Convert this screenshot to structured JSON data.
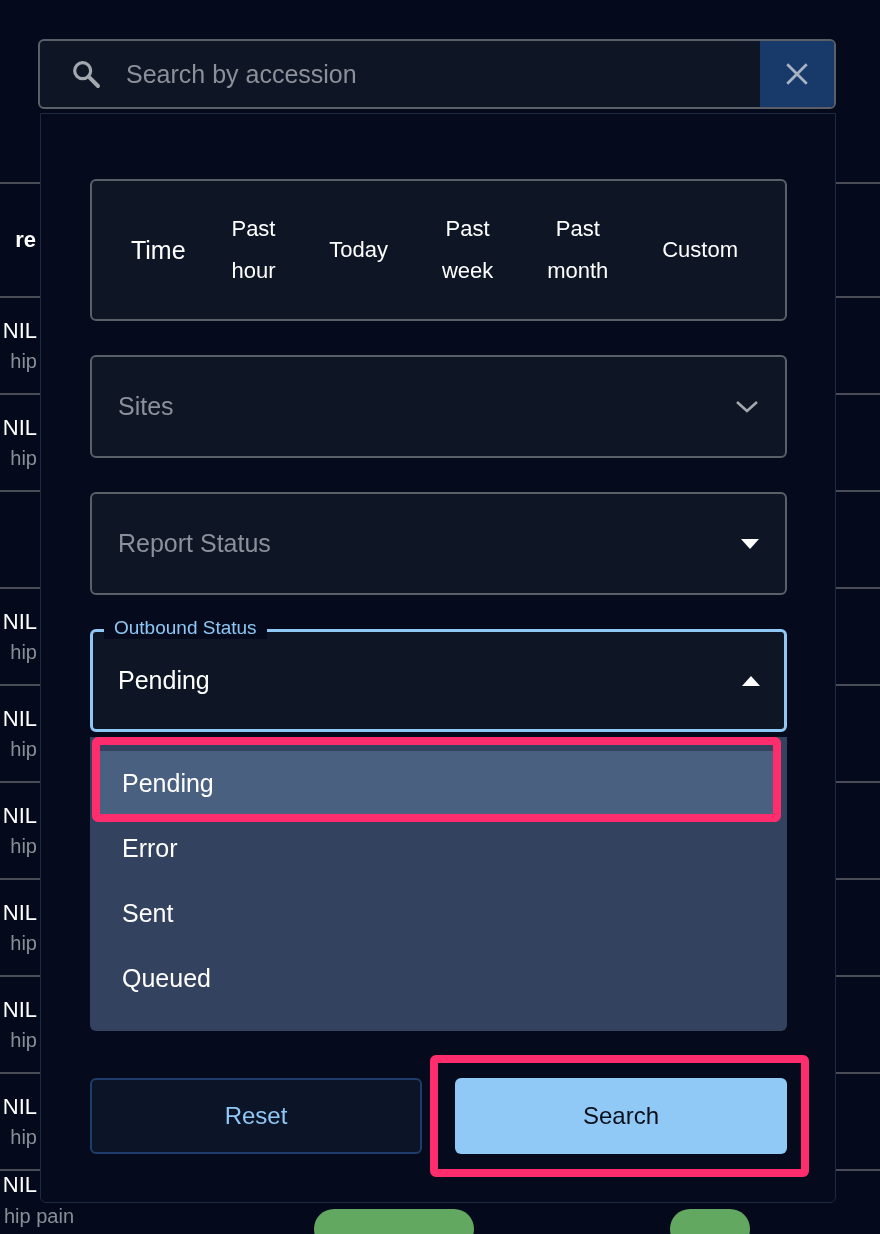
{
  "background_table": {
    "header": "re",
    "rows": [
      {
        "kind": "item",
        "title": "NIL",
        "subtitle": "hip"
      },
      {
        "kind": "item",
        "title": "NIL",
        "subtitle": "hip"
      },
      {
        "kind": "blank"
      },
      {
        "kind": "item",
        "title": "NIL",
        "subtitle": "hip"
      },
      {
        "kind": "item",
        "title": "NIL",
        "subtitle": "hip"
      },
      {
        "kind": "item",
        "title": "NIL",
        "subtitle": "hip"
      },
      {
        "kind": "item",
        "title": "NIL",
        "subtitle": "hip"
      },
      {
        "kind": "item",
        "title": "NIL",
        "subtitle": "hip"
      },
      {
        "kind": "item",
        "title": "NIL",
        "subtitle": "hip"
      },
      {
        "kind": "pills",
        "title": "NIL",
        "subtitle": "hip pain"
      }
    ]
  },
  "search": {
    "placeholder": "Search by accession"
  },
  "filters": {
    "time": {
      "label": "Time",
      "options": [
        {
          "label": "Past hour",
          "selected": false
        },
        {
          "label": "Today",
          "selected": false
        },
        {
          "label": "Past week",
          "selected": false
        },
        {
          "label": "Past month",
          "selected": false
        },
        {
          "label": "Custom",
          "selected": false
        }
      ]
    },
    "sites": {
      "placeholder": "Sites"
    },
    "report_status": {
      "placeholder": "Report Status"
    },
    "outbound_status": {
      "label": "Outbound Status",
      "value": "Pending",
      "expanded": true,
      "options": [
        {
          "label": "Pending",
          "selected": true,
          "highlighted": true
        },
        {
          "label": "Error",
          "selected": false,
          "highlighted": false
        },
        {
          "label": "Sent",
          "selected": false,
          "highlighted": false
        },
        {
          "label": "Queued",
          "selected": false,
          "highlighted": false
        }
      ]
    }
  },
  "buttons": [
    {
      "label": "Reset",
      "kind": "outlined",
      "highlighted": false
    },
    {
      "label": "Search",
      "kind": "filled",
      "highlighted": true
    }
  ]
}
